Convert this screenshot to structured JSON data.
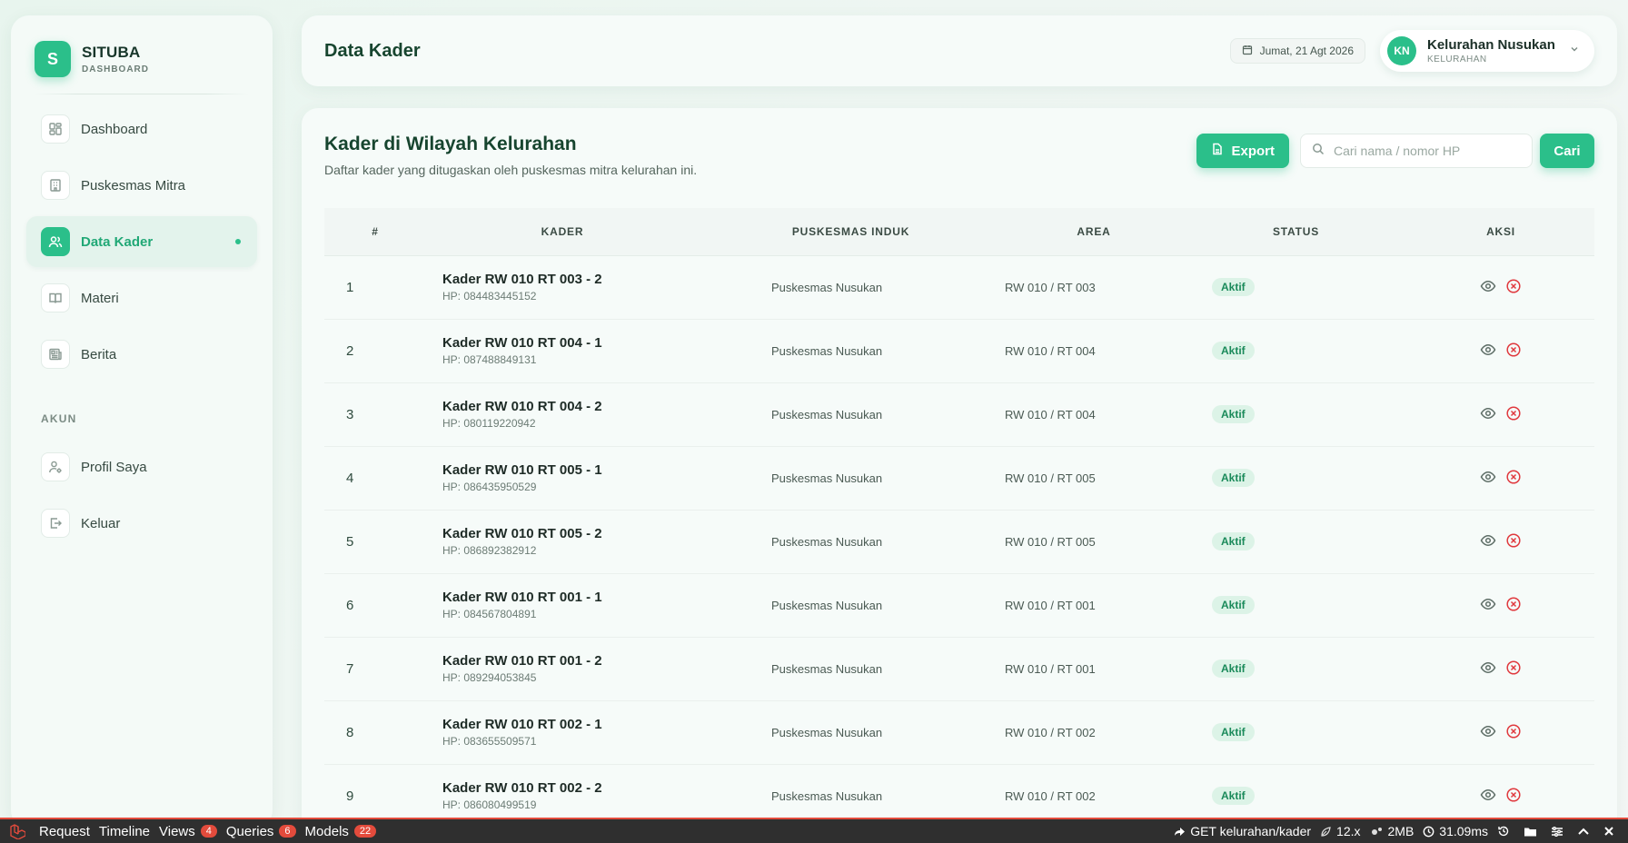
{
  "brand": {
    "logo_letter": "S",
    "name": "SITUBA",
    "sub": "DASHBOARD"
  },
  "sidebar": {
    "items": [
      {
        "label": "Dashboard",
        "icon": "dashboard-icon"
      },
      {
        "label": "Puskesmas Mitra",
        "icon": "building-icon"
      },
      {
        "label": "Data Kader",
        "icon": "users-icon",
        "active": true
      },
      {
        "label": "Materi",
        "icon": "book-icon"
      },
      {
        "label": "Berita",
        "icon": "newspaper-icon"
      }
    ],
    "section_label": "AKUN",
    "account_items": [
      {
        "label": "Profil Saya",
        "icon": "user-settings-icon"
      },
      {
        "label": "Keluar",
        "icon": "logout-icon"
      }
    ]
  },
  "header": {
    "title": "Data Kader",
    "date": "Jumat, 21 Agt 2026",
    "user": {
      "initials": "KN",
      "name": "Kelurahan Nusukan",
      "role": "KELURAHAN"
    }
  },
  "main": {
    "title": "Kader di Wilayah Kelurahan",
    "subtitle": "Daftar kader yang ditugaskan oleh puskesmas mitra kelurahan ini.",
    "export_label": "Export",
    "search_placeholder": "Cari nama / nomor HP",
    "search_value": "",
    "search_button": "Cari",
    "columns": [
      "#",
      "KADER",
      "PUSKESMAS INDUK",
      "AREA",
      "STATUS",
      "AKSI"
    ],
    "rows": [
      {
        "no": "1",
        "name": "Kader RW 010 RT 003 - 2",
        "hp": "HP: 084483445152",
        "puskesmas": "Puskesmas Nusukan",
        "area": "RW 010 / RT 003",
        "status": "Aktif"
      },
      {
        "no": "2",
        "name": "Kader RW 010 RT 004 - 1",
        "hp": "HP: 087488849131",
        "puskesmas": "Puskesmas Nusukan",
        "area": "RW 010 / RT 004",
        "status": "Aktif"
      },
      {
        "no": "3",
        "name": "Kader RW 010 RT 004 - 2",
        "hp": "HP: 080119220942",
        "puskesmas": "Puskesmas Nusukan",
        "area": "RW 010 / RT 004",
        "status": "Aktif"
      },
      {
        "no": "4",
        "name": "Kader RW 010 RT 005 - 1",
        "hp": "HP: 086435950529",
        "puskesmas": "Puskesmas Nusukan",
        "area": "RW 010 / RT 005",
        "status": "Aktif"
      },
      {
        "no": "5",
        "name": "Kader RW 010 RT 005 - 2",
        "hp": "HP: 086892382912",
        "puskesmas": "Puskesmas Nusukan",
        "area": "RW 010 / RT 005",
        "status": "Aktif"
      },
      {
        "no": "6",
        "name": "Kader RW 010 RT 001 - 1",
        "hp": "HP: 084567804891",
        "puskesmas": "Puskesmas Nusukan",
        "area": "RW 010 / RT 001",
        "status": "Aktif"
      },
      {
        "no": "7",
        "name": "Kader RW 010 RT 001 - 2",
        "hp": "HP: 089294053845",
        "puskesmas": "Puskesmas Nusukan",
        "area": "RW 010 / RT 001",
        "status": "Aktif"
      },
      {
        "no": "8",
        "name": "Kader RW 010 RT 002 - 1",
        "hp": "HP: 083655509571",
        "puskesmas": "Puskesmas Nusukan",
        "area": "RW 010 / RT 002",
        "status": "Aktif"
      },
      {
        "no": "9",
        "name": "Kader RW 010 RT 002 - 2",
        "hp": "HP: 086080499519",
        "puskesmas": "Puskesmas Nusukan",
        "area": "RW 010 / RT 002",
        "status": "Aktif"
      }
    ]
  },
  "debugbar": {
    "tabs": [
      {
        "label": "Request"
      },
      {
        "label": "Timeline"
      },
      {
        "label": "Views",
        "count": "4"
      },
      {
        "label": "Queries",
        "count": "6"
      },
      {
        "label": "Models",
        "count": "22"
      }
    ],
    "route": "GET kelurahan/kader",
    "version": "12.x",
    "memory": "2MB",
    "time": "31.09ms"
  },
  "colors": {
    "accent": "#2bbf8a",
    "danger": "#e0393e",
    "debug_red": "#e34b3c"
  }
}
